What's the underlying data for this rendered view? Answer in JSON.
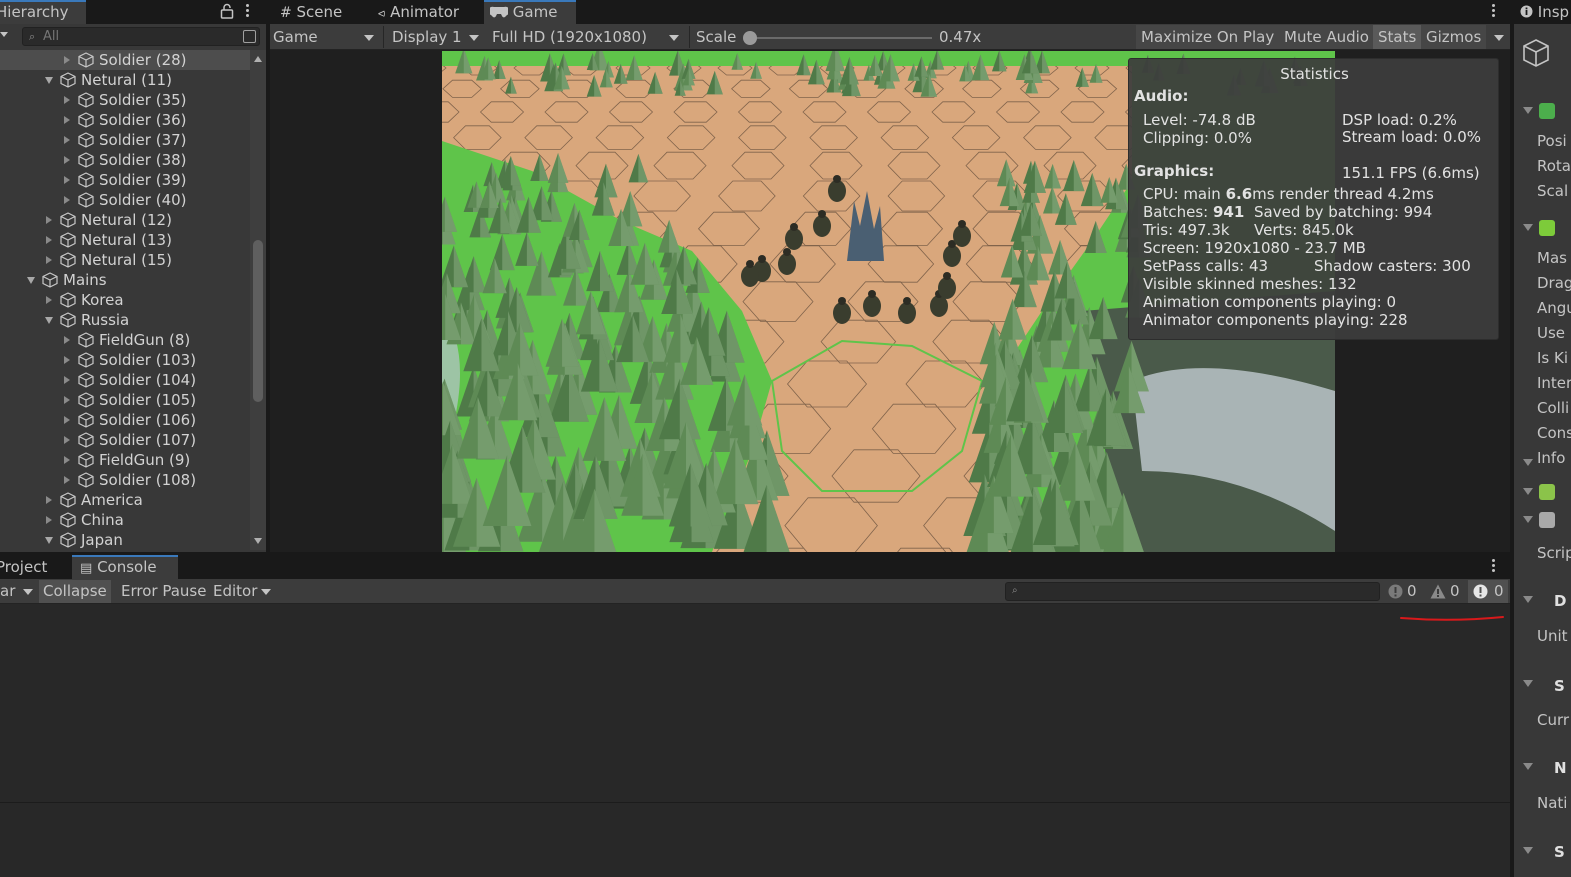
{
  "hierarchy": {
    "tab_label": "Hierarchy",
    "search_placeholder": "All",
    "rows": [
      {
        "label": "Soldier (28)",
        "indent": 3,
        "state": "collapsed",
        "selected": true
      },
      {
        "label": "Netural (11)",
        "indent": 2,
        "state": "expanded"
      },
      {
        "label": "Soldier (35)",
        "indent": 3,
        "state": "collapsed"
      },
      {
        "label": "Soldier (36)",
        "indent": 3,
        "state": "collapsed"
      },
      {
        "label": "Soldier (37)",
        "indent": 3,
        "state": "collapsed"
      },
      {
        "label": "Soldier (38)",
        "indent": 3,
        "state": "collapsed"
      },
      {
        "label": "Soldier (39)",
        "indent": 3,
        "state": "collapsed"
      },
      {
        "label": "Soldier (40)",
        "indent": 3,
        "state": "collapsed"
      },
      {
        "label": "Netural (12)",
        "indent": 2,
        "state": "collapsed"
      },
      {
        "label": "Netural (13)",
        "indent": 2,
        "state": "collapsed"
      },
      {
        "label": "Netural (15)",
        "indent": 2,
        "state": "collapsed"
      },
      {
        "label": "Mains",
        "indent": 1,
        "state": "expanded"
      },
      {
        "label": "Korea",
        "indent": 2,
        "state": "collapsed"
      },
      {
        "label": "Russia",
        "indent": 2,
        "state": "expanded"
      },
      {
        "label": "FieldGun (8)",
        "indent": 3,
        "state": "collapsed"
      },
      {
        "label": "Soldier (103)",
        "indent": 3,
        "state": "collapsed"
      },
      {
        "label": "Soldier (104)",
        "indent": 3,
        "state": "collapsed"
      },
      {
        "label": "Soldier (105)",
        "indent": 3,
        "state": "collapsed"
      },
      {
        "label": "Soldier (106)",
        "indent": 3,
        "state": "collapsed"
      },
      {
        "label": "Soldier (107)",
        "indent": 3,
        "state": "collapsed"
      },
      {
        "label": "FieldGun (9)",
        "indent": 3,
        "state": "collapsed"
      },
      {
        "label": "Soldier (108)",
        "indent": 3,
        "state": "collapsed"
      },
      {
        "label": "America",
        "indent": 2,
        "state": "collapsed"
      },
      {
        "label": "China",
        "indent": 2,
        "state": "collapsed"
      },
      {
        "label": "Japan",
        "indent": 2,
        "state": "expanded"
      }
    ]
  },
  "game_panel": {
    "tabs": {
      "scene": "Scene",
      "animator": "Animator",
      "game": "Game"
    },
    "toolbar": {
      "view_mode": "Game",
      "display": "Display 1",
      "resolution": "Full HD (1920x1080)",
      "scale_label": "Scale",
      "scale_value": "0.47x",
      "scale_fraction": 0.0,
      "maximize_on_play": "Maximize On Play",
      "mute_audio": "Mute Audio",
      "stats": "Stats",
      "gizmos": "Gizmos"
    },
    "statistics": {
      "title": "Statistics",
      "audio_header": "Audio:",
      "level": "Level: -74.8 dB",
      "clipping": "Clipping: 0.0%",
      "dsp_load": "DSP load: 0.2%",
      "stream_load": "Stream load: 0.0%",
      "graphics_header": "Graphics:",
      "fps": "151.1 FPS (6.6ms)",
      "cpu_prefix": "CPU: main ",
      "cpu_main": "6.6",
      "cpu_suffix": "ms  render thread 4.2ms",
      "batches_prefix": "Batches: ",
      "batches": "941",
      "saved_by_batching": "Saved by batching: 994",
      "tris": "Tris: 497.3k",
      "verts": "Verts: 845.0k",
      "screen": "Screen: 1920x1080 - 23.7 MB",
      "setpass": "SetPass calls: 43",
      "shadow_casters": "Shadow casters: 300",
      "skinned_meshes": "Visible skinned meshes: 132",
      "animation_components": "Animation components playing: 0",
      "animator_components": "Animator components playing: 228"
    }
  },
  "console_panel": {
    "tabs": {
      "project": "Project",
      "console": "Console"
    },
    "toolbar": {
      "clear": "ar",
      "collapse": "Collapse",
      "error_pause": "Error Pause",
      "editor": "Editor",
      "log_count": "0",
      "warning_count": "0",
      "error_count": "0"
    }
  },
  "inspector": {
    "tab_label": "Insp",
    "fields": [
      "Posi",
      "Rota",
      "Scal",
      "Mas",
      "Drag",
      "Angu",
      "Use",
      "Is Ki",
      "Inter",
      "Colli",
      "Cons",
      "Info",
      "Scrip",
      "D",
      "Unit",
      "S",
      "Curr",
      "N",
      "Nati",
      "S"
    ]
  },
  "colors": {
    "accent": "#3a79bb",
    "panel_bg": "#383838",
    "toolbar_bg": "#3c3c3c",
    "grass": "#5fc44a",
    "hex_tile": "#d9a77c",
    "annotation_red": "#d9191b"
  }
}
